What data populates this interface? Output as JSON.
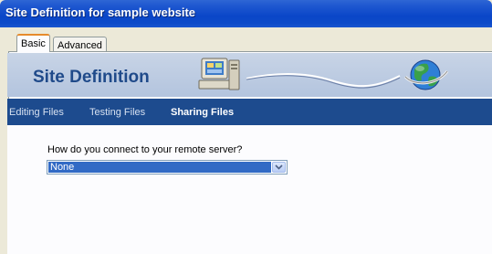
{
  "window": {
    "title": "Site Definition for sample website"
  },
  "tabs": [
    {
      "label": "Basic",
      "active": true
    },
    {
      "label": "Advanced",
      "active": false
    }
  ],
  "banner": {
    "title": "Site Definition"
  },
  "nav": {
    "items": [
      {
        "label": "Editing Files",
        "active": false
      },
      {
        "label": "Testing Files",
        "active": false
      },
      {
        "label": "Sharing Files",
        "active": true
      }
    ]
  },
  "form": {
    "question": "How do you connect to your remote server?",
    "connection_select": {
      "value": "None"
    }
  },
  "colors": {
    "titlebar": "#0a46c8",
    "navbar": "#1d4b8e",
    "banner": "#b3c4de",
    "selection": "#316ac5",
    "tab_highlight": "#e68b2c"
  },
  "icons": [
    "computer-icon",
    "network-cable",
    "globe-icon",
    "chevron-down-icon"
  ]
}
